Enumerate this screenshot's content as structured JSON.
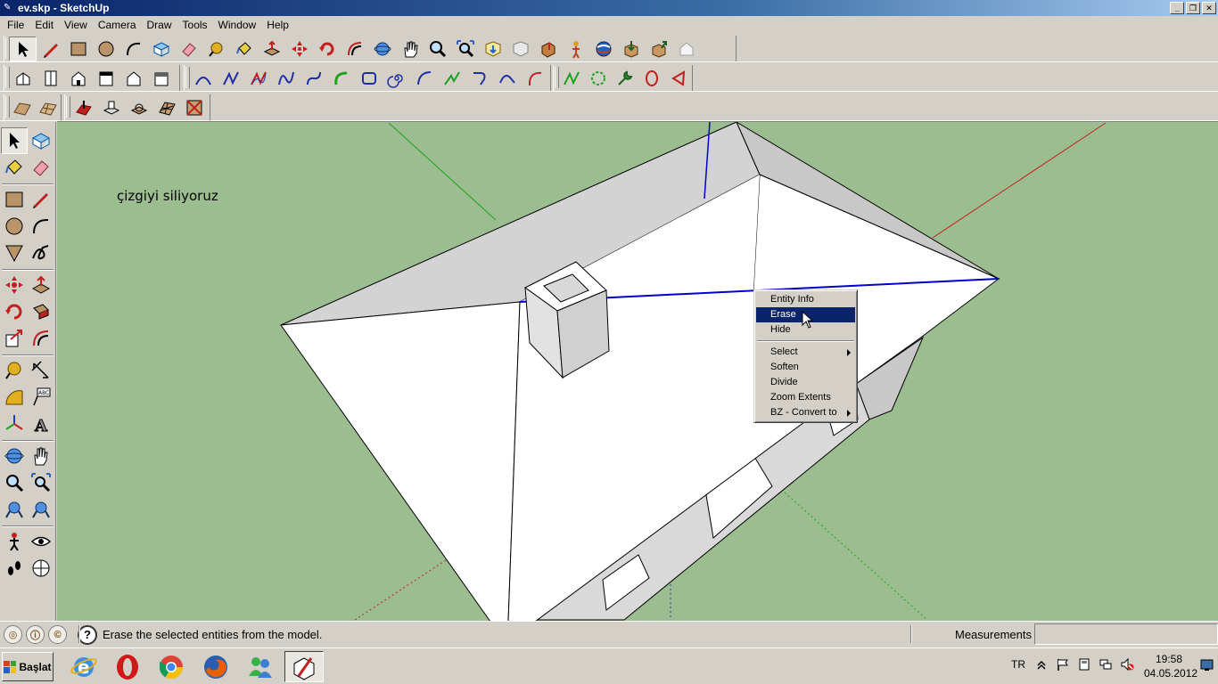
{
  "window": {
    "title": "ev.skp - SketchUp"
  },
  "menu": [
    "File",
    "Edit",
    "View",
    "Camera",
    "Draw",
    "Tools",
    "Window",
    "Help"
  ],
  "canvas": {
    "annotation": "çizgiyi siliyoruz"
  },
  "context_menu": {
    "items": [
      "Entity Info",
      "Erase",
      "Hide",
      "Select",
      "Soften",
      "Divide",
      "Zoom Extents",
      "BZ - Convert to"
    ],
    "highlighted": "Erase",
    "submenu_items": [
      "Select",
      "BZ - Convert to"
    ]
  },
  "status": {
    "hint": "Erase the selected entities from the model.",
    "measurements_label": "Measurements",
    "measurements_value": ""
  },
  "taskbar": {
    "start_label": "Başlat",
    "language": "TR",
    "time": "19:58",
    "date": "04.05.2012"
  },
  "colors": {
    "sky_ground": "#9cbd8f",
    "selection_blue": "#0000cc",
    "menu_highlight": "#0a246a"
  }
}
